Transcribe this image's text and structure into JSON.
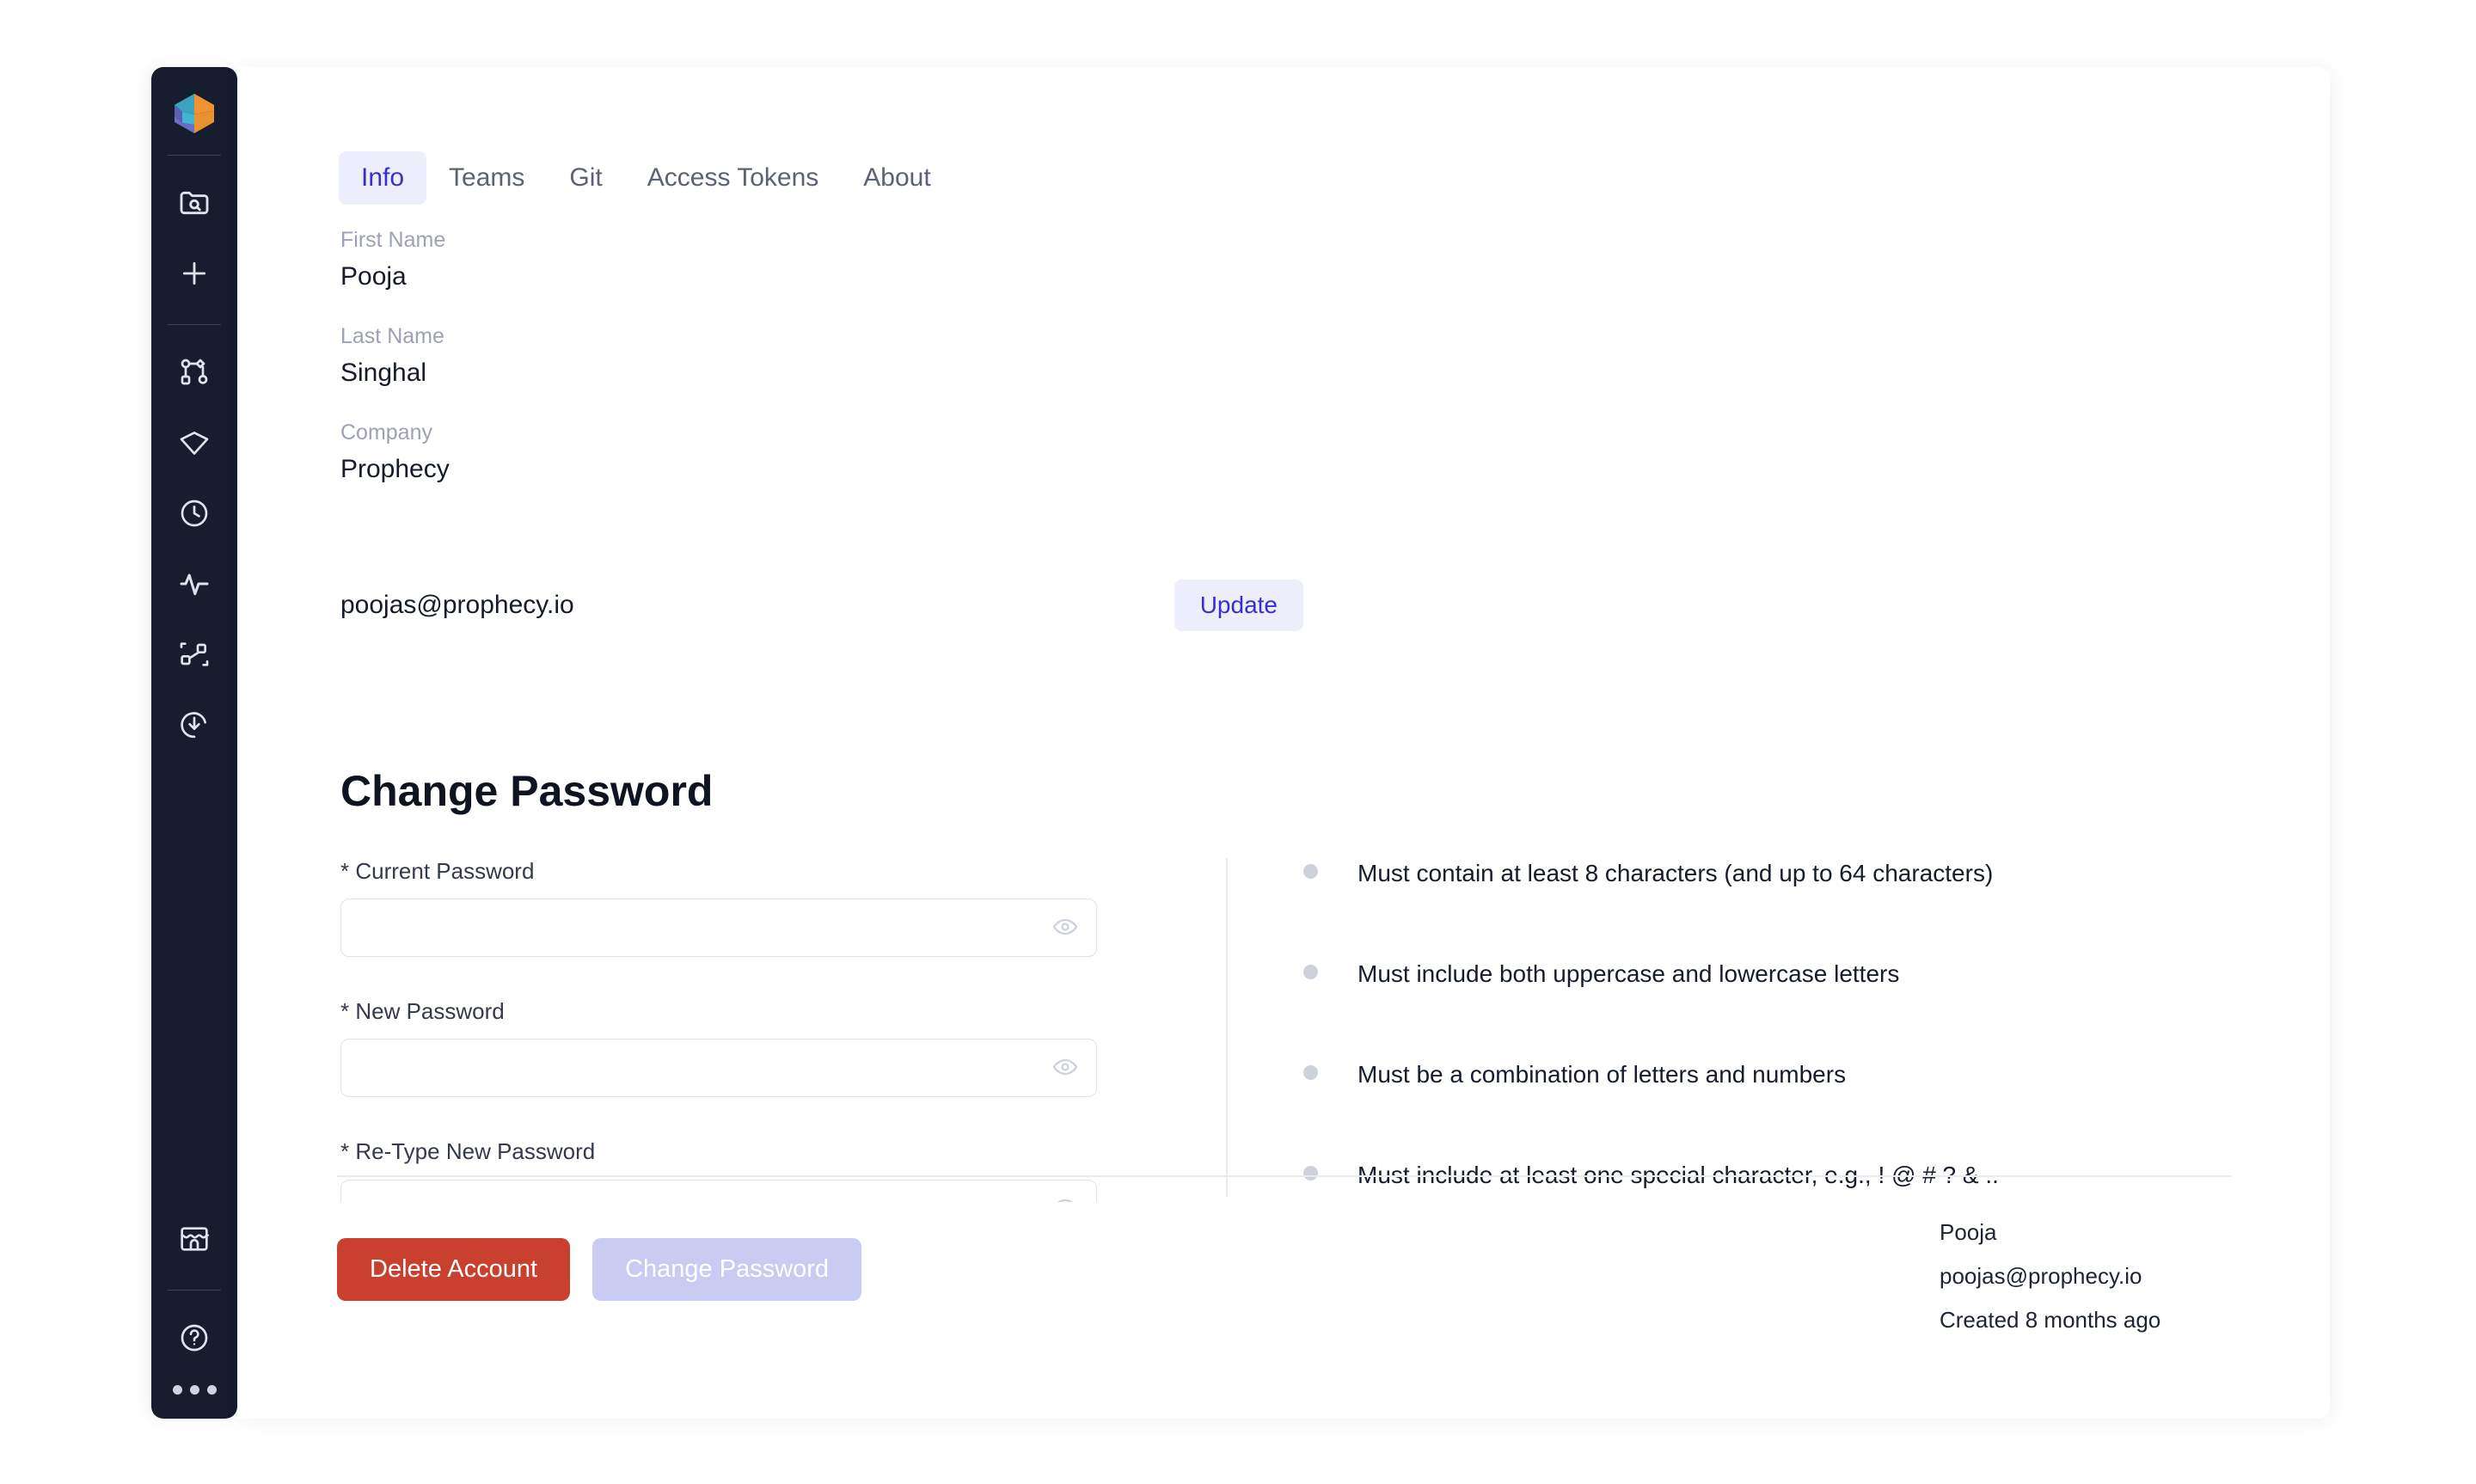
{
  "sidebar": {
    "logo_name": "prophecy-logo",
    "items": [
      {
        "icon": "folder-search-icon",
        "label": "Browse projects"
      },
      {
        "icon": "plus-icon",
        "label": "Create new"
      },
      {
        "icon": "pipeline-graph-icon",
        "label": "Pipelines"
      },
      {
        "icon": "gem-icon",
        "label": "Gems"
      },
      {
        "icon": "clock-icon",
        "label": "Scheduled jobs"
      },
      {
        "icon": "activity-pulse-icon",
        "label": "Monitoring"
      },
      {
        "icon": "cluster-scan-icon",
        "label": "Clusters"
      },
      {
        "icon": "download-circle-icon",
        "label": "Deployments"
      }
    ],
    "bottom_items": [
      {
        "icon": "storefront-icon",
        "label": "Marketplace"
      },
      {
        "icon": "help-circle-icon",
        "label": "Help"
      }
    ],
    "more_icon": "more-ellipsis-icon"
  },
  "tabs": [
    {
      "label": "Info",
      "active": true
    },
    {
      "label": "Teams",
      "active": false
    },
    {
      "label": "Git",
      "active": false
    },
    {
      "label": "Access Tokens",
      "active": false
    },
    {
      "label": "About",
      "active": false
    }
  ],
  "profile": {
    "first_name_label": "First Name",
    "first_name_value": "Pooja",
    "last_name_label": "Last Name",
    "last_name_value": "Singhal",
    "company_label": "Company",
    "company_value": "Prophecy",
    "email_value": "poojas@prophecy.io",
    "update_label": "Update"
  },
  "change_password": {
    "title": "Change Password",
    "current_password_label": "* Current Password",
    "current_password_value": "",
    "current_password_placeholder": "",
    "new_password_label": "* New Password",
    "new_password_value": "",
    "new_password_placeholder": "",
    "retype_password_label": "* Re-Type New Password",
    "retype_password_value": "",
    "retype_password_placeholder": "",
    "show_password_icon": "eye-icon"
  },
  "requirements": [
    "Must contain at least 8 characters (and up to 64 characters)",
    "Must include both uppercase and lowercase letters",
    "Must be a combination of letters and numbers",
    "Must include at least one special character, e.g., ! @ # ? & .."
  ],
  "actions": {
    "delete_account_label": "Delete Account",
    "change_password_label": "Change Password"
  },
  "meta": {
    "name": "Pooja",
    "email": "poojas@prophecy.io",
    "created": "Created 8 months ago"
  },
  "colors": {
    "sidebar_bg": "#161d2e",
    "accent": "#3730cf",
    "accent_soft": "#eceefc",
    "danger": "#c9402e",
    "disabled": "#c8ccf3",
    "text": "#141b2b",
    "muted": "#9aa2b4",
    "border": "#dfe2ea"
  }
}
